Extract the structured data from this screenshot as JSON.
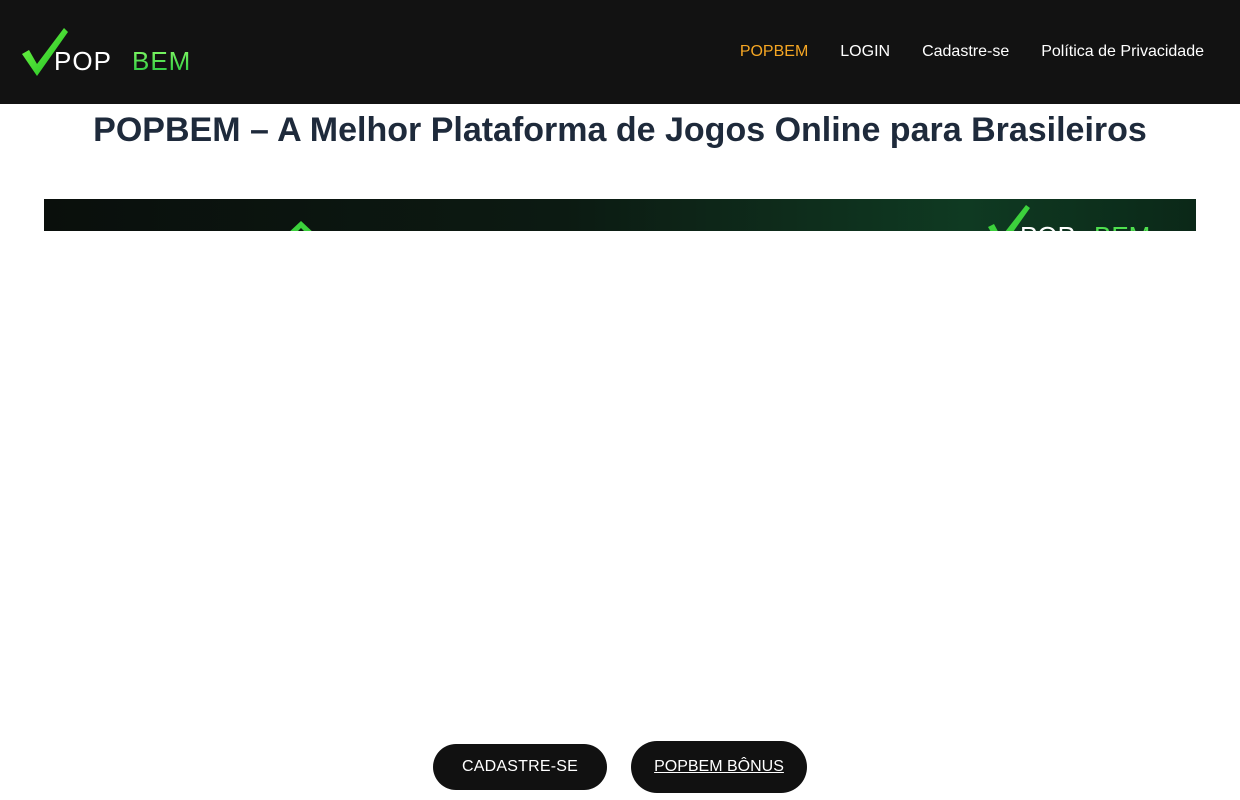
{
  "header": {
    "logo_text": "POPBEM",
    "nav": [
      {
        "label": "POPBEM"
      },
      {
        "label": "LOGIN"
      },
      {
        "label": "Cadastre-se"
      },
      {
        "label": "Política de Privacidade"
      }
    ],
    "active_color": "#f5a623",
    "background": "#121212"
  },
  "main": {
    "title": "POPBEM – A Melhor Plataforma de Jogos Online para Brasileiros"
  },
  "cta": {
    "signup_label": "CADASTRE-SE",
    "bonus_label": "POPBEM BÔNUS"
  },
  "colors": {
    "brand_green": "#3cd13c",
    "title": "#1e2a3b"
  }
}
